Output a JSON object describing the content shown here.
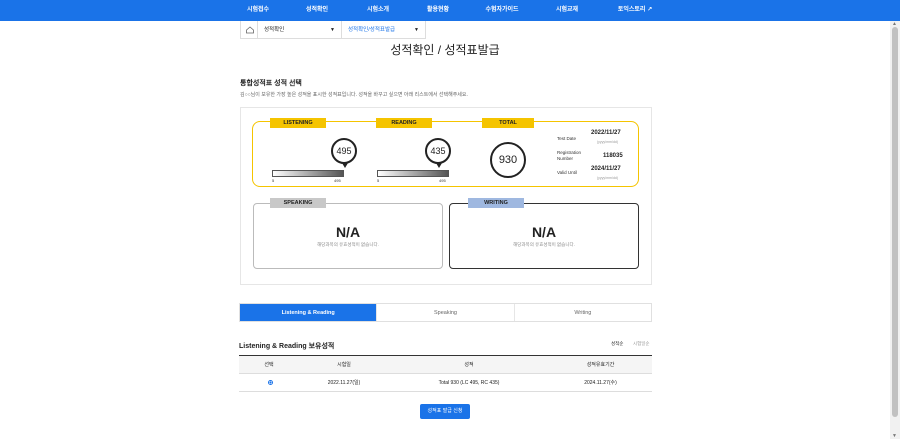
{
  "nav": {
    "items": [
      "시험접수",
      "성적확인",
      "시험소개",
      "활용현황",
      "수험자가이드",
      "시험교재",
      "토익스토리 ↗"
    ]
  },
  "breadcrumb": {
    "level1": "성적확인",
    "level2": "성적확인/성적표발급"
  },
  "page_title": "성적확인 / 성적표발급",
  "section": {
    "heading": "통합성적표 성적 선택",
    "description": "김○○님이 보유한 가장 높은 성적을 표시한 성적표입니다. 성적을 바꾸고 싶으면 아래 리스트에서 선택해주세요."
  },
  "scores": {
    "listening": {
      "label": "LISTENING",
      "score": "495",
      "min": "5",
      "max": "495",
      "fraction": 1.0
    },
    "reading": {
      "label": "READING",
      "score": "435",
      "min": "5",
      "max": "495",
      "fraction": 0.877
    },
    "total": {
      "label": "TOTAL",
      "score": "930"
    },
    "test_date_label": "Test Date",
    "test_date": "2022/11/27",
    "date_format": "(yyyy/mm/dd)",
    "reg_label": "Registration Number",
    "reg_number": "118035",
    "valid_label": "Valid Until",
    "valid_until": "2024/11/27",
    "speaking": {
      "label": "SPEAKING",
      "value": "N/A",
      "msg": "해당과목의 유효성적이 없습니다."
    },
    "writing": {
      "label": "WRITING",
      "value": "N/A",
      "msg": "해당과목의 유효성적이 없습니다."
    }
  },
  "tabs": [
    "Listening & Reading",
    "Speaking",
    "Writing"
  ],
  "list": {
    "heading": "Listening & Reading 보유성적",
    "sort_score": "성적순",
    "sort_date": "시험일순",
    "columns": [
      "선택",
      "시험일",
      "성적",
      "성적유효기간"
    ],
    "rows": [
      {
        "date": "2022.11.27(일)",
        "score": "Total 930 (LC 495, RC 435)",
        "valid": "2024.11.27(수)"
      }
    ]
  },
  "issue_button": "성적표 발급 신청",
  "colors": {
    "brand": "#1a73e8",
    "highlight": "#f5c400"
  }
}
